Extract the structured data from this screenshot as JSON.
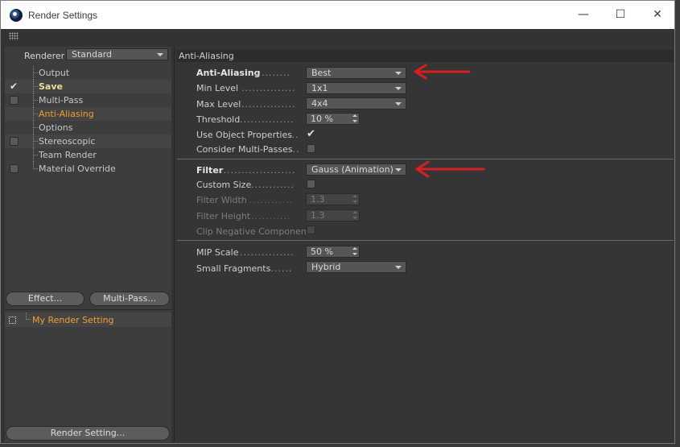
{
  "window": {
    "title": "Render Settings",
    "controls": {
      "minimize": "—",
      "maximize": "☐",
      "close": "✕"
    }
  },
  "left_panel": {
    "renderer_label": "Renderer",
    "renderer_value": "Standard",
    "tree": [
      {
        "label": "Output",
        "checkbox": "none",
        "state": "normal"
      },
      {
        "label": "Save",
        "checkbox": "checked",
        "state": "bold"
      },
      {
        "label": "Multi-Pass",
        "checkbox": "unchecked",
        "state": "normal"
      },
      {
        "label": "Anti-Aliasing",
        "checkbox": "none",
        "state": "active"
      },
      {
        "label": "Options",
        "checkbox": "none",
        "state": "normal"
      },
      {
        "label": "Stereoscopic",
        "checkbox": "unchecked",
        "state": "normal"
      },
      {
        "label": "Team Render",
        "checkbox": "none",
        "state": "normal"
      },
      {
        "label": "Material Override",
        "checkbox": "unchecked",
        "state": "normal"
      }
    ],
    "effect_button": "Effect...",
    "multipass_button": "Multi-Pass...",
    "my_render_setting": "My Render Setting",
    "render_setting_button": "Render Setting..."
  },
  "right_panel": {
    "section_title": "Anti-Aliasing",
    "anti_aliasing": {
      "label": "Anti-Aliasing",
      "value": "Best"
    },
    "min_level": {
      "label": "Min Level",
      "value": "1x1"
    },
    "max_level": {
      "label": "Max Level",
      "value": "4x4"
    },
    "threshold": {
      "label": "Threshold",
      "value": "10 %"
    },
    "use_object_properties": {
      "label": "Use Object Properties",
      "checked": true
    },
    "consider_multi_passes": {
      "label": "Consider Multi-Passes",
      "checked": false
    },
    "filter": {
      "label": "Filter",
      "value": "Gauss (Animation)"
    },
    "custom_size": {
      "label": "Custom Size",
      "checked": false
    },
    "filter_width": {
      "label": "Filter Width",
      "value": "1.3"
    },
    "filter_height": {
      "label": "Filter Height",
      "value": "1.3"
    },
    "clip_negative_component": {
      "label": "Clip Negative Component",
      "checked": false
    },
    "mip_scale": {
      "label": "MIP Scale",
      "value": "50 %"
    },
    "small_fragments": {
      "label": "Small Fragments",
      "value": "Hybrid"
    }
  },
  "colors": {
    "accent_active": "#f0a030",
    "annotation_arrow": "#d42020"
  }
}
